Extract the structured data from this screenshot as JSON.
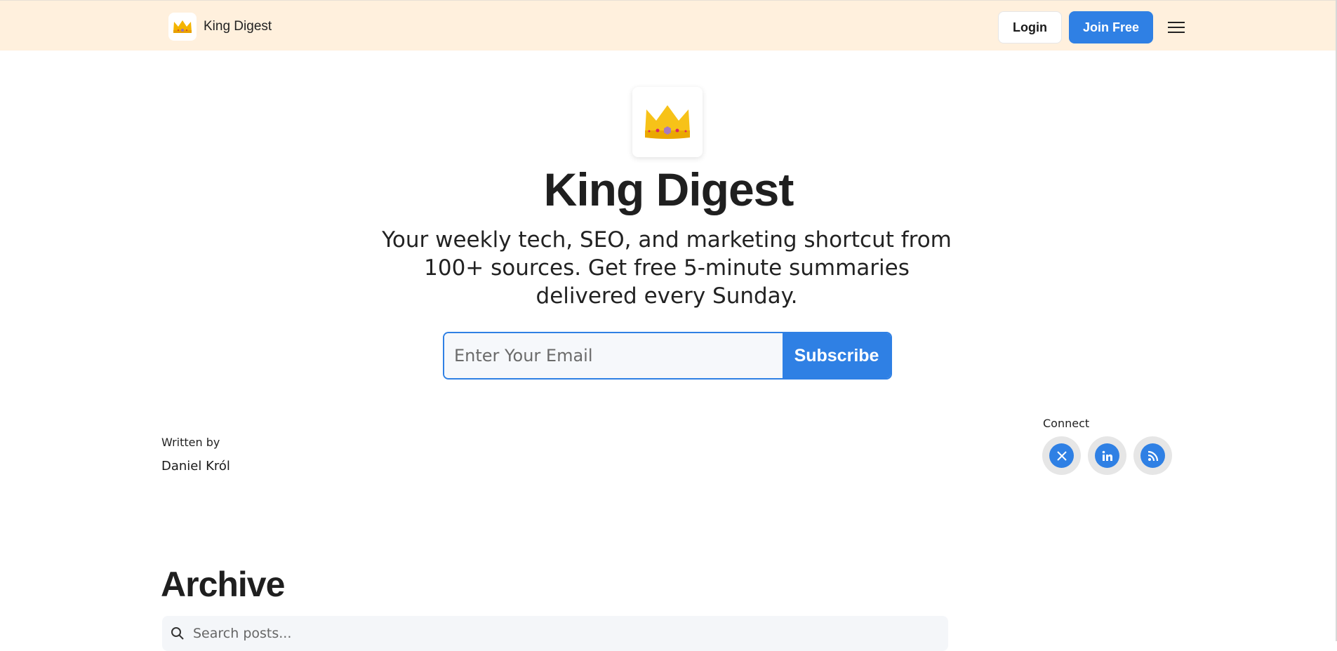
{
  "header": {
    "brand_name": "King Digest",
    "login_label": "Login",
    "join_label": "Join Free",
    "logo_icon": "crown-icon",
    "menu_icon": "hamburger-menu-icon"
  },
  "hero": {
    "title": "King Digest",
    "subtitle": "Your weekly tech, SEO, and marketing shortcut from 100+ sources. Get free 5-minute summaries delivered every Sunday.",
    "email_placeholder": "Enter Your Email",
    "subscribe_label": "Subscribe"
  },
  "author": {
    "label": "Written by",
    "name": "Daniel Król"
  },
  "connect": {
    "label": "Connect",
    "links": [
      {
        "icon": "x-twitter-icon",
        "glyph": "𝕏"
      },
      {
        "icon": "linkedin-icon",
        "glyph": "in"
      },
      {
        "icon": "rss-icon",
        "glyph": ""
      }
    ]
  },
  "archive": {
    "title": "Archive",
    "search_placeholder": "Search posts..."
  },
  "colors": {
    "accent": "#2f80e4",
    "topbar_bg": "#fff0dd"
  }
}
